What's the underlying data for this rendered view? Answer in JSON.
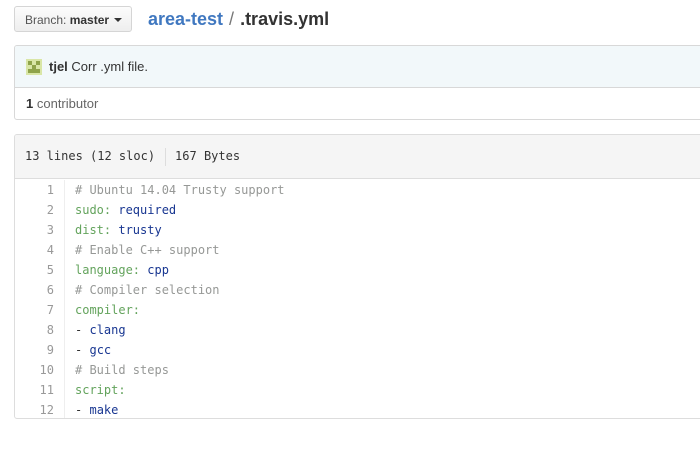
{
  "branch": {
    "prefix": "Branch:",
    "name": "master"
  },
  "breadcrumb": {
    "repo": "area-test",
    "separator": "/",
    "file": ".travis.yml"
  },
  "commit": {
    "author": "tjel",
    "message": "Corr .yml file."
  },
  "contributors": {
    "count": "1",
    "label": "contributor"
  },
  "file_info": {
    "lines": "13 lines (12 sloc)",
    "size": "167 Bytes"
  },
  "code_lines": [
    {
      "n": "1",
      "parts": [
        {
          "t": "# Ubuntu 14.04 Trusty support",
          "c": "comment"
        }
      ]
    },
    {
      "n": "2",
      "parts": [
        {
          "t": "sudo:",
          "c": "key"
        },
        {
          "t": " ",
          "c": ""
        },
        {
          "t": "required",
          "c": "val"
        }
      ]
    },
    {
      "n": "3",
      "parts": [
        {
          "t": "dist:",
          "c": "key"
        },
        {
          "t": " ",
          "c": ""
        },
        {
          "t": "trusty",
          "c": "val"
        }
      ]
    },
    {
      "n": "4",
      "parts": [
        {
          "t": "# Enable C++ support",
          "c": "comment"
        }
      ]
    },
    {
      "n": "5",
      "parts": [
        {
          "t": "language:",
          "c": "key"
        },
        {
          "t": " ",
          "c": ""
        },
        {
          "t": "cpp",
          "c": "val"
        }
      ]
    },
    {
      "n": "6",
      "parts": [
        {
          "t": "# Compiler selection",
          "c": "comment"
        }
      ]
    },
    {
      "n": "7",
      "parts": [
        {
          "t": "compiler:",
          "c": "key"
        }
      ]
    },
    {
      "n": "8",
      "parts": [
        {
          "t": "-",
          "c": "dash"
        },
        {
          "t": " ",
          "c": ""
        },
        {
          "t": "clang",
          "c": "val"
        }
      ]
    },
    {
      "n": "9",
      "parts": [
        {
          "t": "-",
          "c": "dash"
        },
        {
          "t": " ",
          "c": ""
        },
        {
          "t": "gcc",
          "c": "val"
        }
      ]
    },
    {
      "n": "10",
      "parts": [
        {
          "t": "# Build steps",
          "c": "comment"
        }
      ]
    },
    {
      "n": "11",
      "parts": [
        {
          "t": "script:",
          "c": "key"
        }
      ]
    },
    {
      "n": "12",
      "parts": [
        {
          "t": "-",
          "c": "dash"
        },
        {
          "t": " ",
          "c": ""
        },
        {
          "t": "make",
          "c": "val"
        }
      ]
    }
  ],
  "colors": {
    "link": "#4078c0",
    "comment": "#969896",
    "key": "#63a35c",
    "value": "#183691",
    "commit_bg": "#f2f8fa"
  }
}
